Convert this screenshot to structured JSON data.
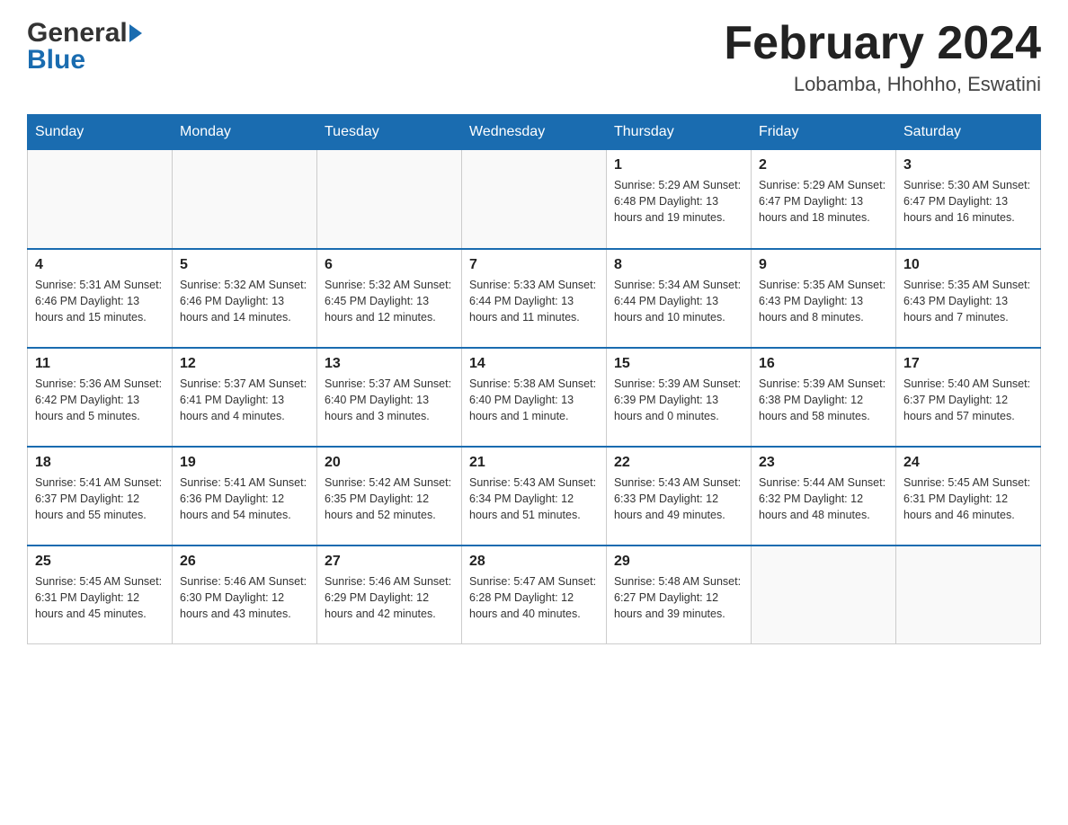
{
  "header": {
    "logo_general": "General",
    "logo_blue": "Blue",
    "month_title": "February 2024",
    "location": "Lobamba, Hhohho, Eswatini"
  },
  "days_of_week": [
    "Sunday",
    "Monday",
    "Tuesday",
    "Wednesday",
    "Thursday",
    "Friday",
    "Saturday"
  ],
  "weeks": [
    {
      "days": [
        {
          "number": "",
          "info": ""
        },
        {
          "number": "",
          "info": ""
        },
        {
          "number": "",
          "info": ""
        },
        {
          "number": "",
          "info": ""
        },
        {
          "number": "1",
          "info": "Sunrise: 5:29 AM\nSunset: 6:48 PM\nDaylight: 13 hours and 19 minutes."
        },
        {
          "number": "2",
          "info": "Sunrise: 5:29 AM\nSunset: 6:47 PM\nDaylight: 13 hours and 18 minutes."
        },
        {
          "number": "3",
          "info": "Sunrise: 5:30 AM\nSunset: 6:47 PM\nDaylight: 13 hours and 16 minutes."
        }
      ]
    },
    {
      "days": [
        {
          "number": "4",
          "info": "Sunrise: 5:31 AM\nSunset: 6:46 PM\nDaylight: 13 hours and 15 minutes."
        },
        {
          "number": "5",
          "info": "Sunrise: 5:32 AM\nSunset: 6:46 PM\nDaylight: 13 hours and 14 minutes."
        },
        {
          "number": "6",
          "info": "Sunrise: 5:32 AM\nSunset: 6:45 PM\nDaylight: 13 hours and 12 minutes."
        },
        {
          "number": "7",
          "info": "Sunrise: 5:33 AM\nSunset: 6:44 PM\nDaylight: 13 hours and 11 minutes."
        },
        {
          "number": "8",
          "info": "Sunrise: 5:34 AM\nSunset: 6:44 PM\nDaylight: 13 hours and 10 minutes."
        },
        {
          "number": "9",
          "info": "Sunrise: 5:35 AM\nSunset: 6:43 PM\nDaylight: 13 hours and 8 minutes."
        },
        {
          "number": "10",
          "info": "Sunrise: 5:35 AM\nSunset: 6:43 PM\nDaylight: 13 hours and 7 minutes."
        }
      ]
    },
    {
      "days": [
        {
          "number": "11",
          "info": "Sunrise: 5:36 AM\nSunset: 6:42 PM\nDaylight: 13 hours and 5 minutes."
        },
        {
          "number": "12",
          "info": "Sunrise: 5:37 AM\nSunset: 6:41 PM\nDaylight: 13 hours and 4 minutes."
        },
        {
          "number": "13",
          "info": "Sunrise: 5:37 AM\nSunset: 6:40 PM\nDaylight: 13 hours and 3 minutes."
        },
        {
          "number": "14",
          "info": "Sunrise: 5:38 AM\nSunset: 6:40 PM\nDaylight: 13 hours and 1 minute."
        },
        {
          "number": "15",
          "info": "Sunrise: 5:39 AM\nSunset: 6:39 PM\nDaylight: 13 hours and 0 minutes."
        },
        {
          "number": "16",
          "info": "Sunrise: 5:39 AM\nSunset: 6:38 PM\nDaylight: 12 hours and 58 minutes."
        },
        {
          "number": "17",
          "info": "Sunrise: 5:40 AM\nSunset: 6:37 PM\nDaylight: 12 hours and 57 minutes."
        }
      ]
    },
    {
      "days": [
        {
          "number": "18",
          "info": "Sunrise: 5:41 AM\nSunset: 6:37 PM\nDaylight: 12 hours and 55 minutes."
        },
        {
          "number": "19",
          "info": "Sunrise: 5:41 AM\nSunset: 6:36 PM\nDaylight: 12 hours and 54 minutes."
        },
        {
          "number": "20",
          "info": "Sunrise: 5:42 AM\nSunset: 6:35 PM\nDaylight: 12 hours and 52 minutes."
        },
        {
          "number": "21",
          "info": "Sunrise: 5:43 AM\nSunset: 6:34 PM\nDaylight: 12 hours and 51 minutes."
        },
        {
          "number": "22",
          "info": "Sunrise: 5:43 AM\nSunset: 6:33 PM\nDaylight: 12 hours and 49 minutes."
        },
        {
          "number": "23",
          "info": "Sunrise: 5:44 AM\nSunset: 6:32 PM\nDaylight: 12 hours and 48 minutes."
        },
        {
          "number": "24",
          "info": "Sunrise: 5:45 AM\nSunset: 6:31 PM\nDaylight: 12 hours and 46 minutes."
        }
      ]
    },
    {
      "days": [
        {
          "number": "25",
          "info": "Sunrise: 5:45 AM\nSunset: 6:31 PM\nDaylight: 12 hours and 45 minutes."
        },
        {
          "number": "26",
          "info": "Sunrise: 5:46 AM\nSunset: 6:30 PM\nDaylight: 12 hours and 43 minutes."
        },
        {
          "number": "27",
          "info": "Sunrise: 5:46 AM\nSunset: 6:29 PM\nDaylight: 12 hours and 42 minutes."
        },
        {
          "number": "28",
          "info": "Sunrise: 5:47 AM\nSunset: 6:28 PM\nDaylight: 12 hours and 40 minutes."
        },
        {
          "number": "29",
          "info": "Sunrise: 5:48 AM\nSunset: 6:27 PM\nDaylight: 12 hours and 39 minutes."
        },
        {
          "number": "",
          "info": ""
        },
        {
          "number": "",
          "info": ""
        }
      ]
    }
  ]
}
